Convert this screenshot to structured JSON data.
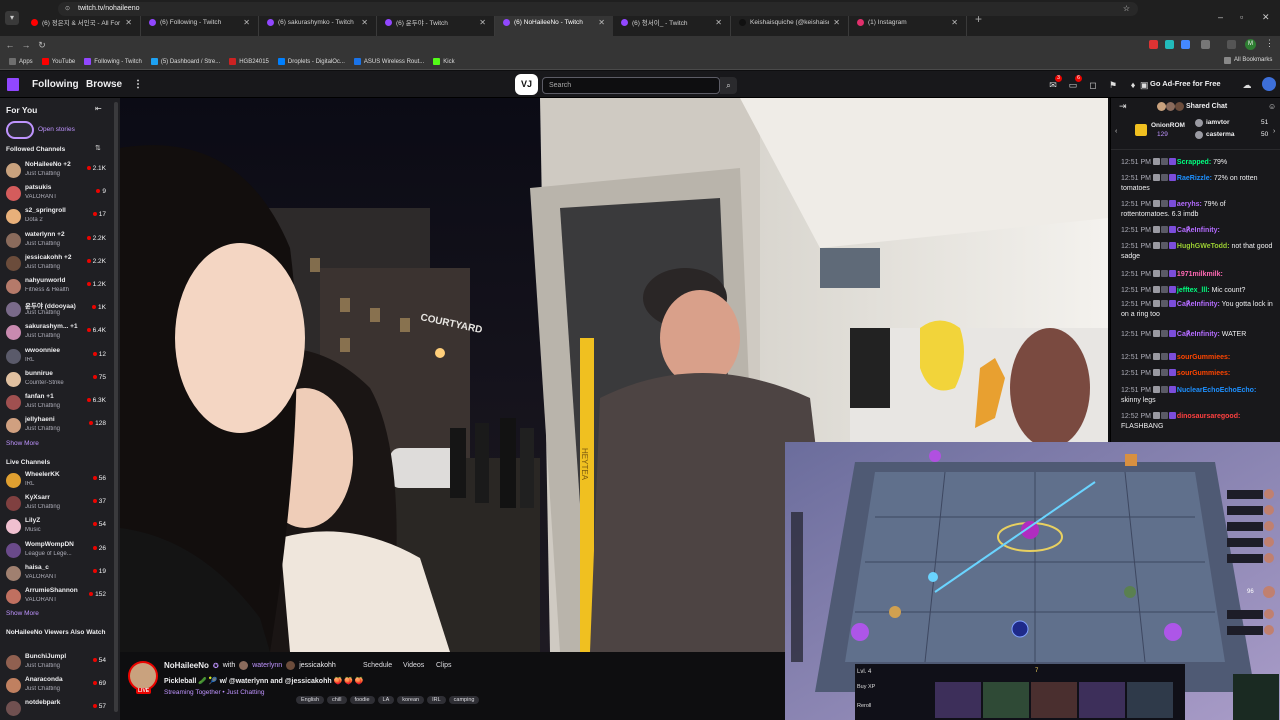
{
  "browser": {
    "tabs": [
      {
        "title": "(6) 정은지 & 서인국 - All For You",
        "color": "#ff0000"
      },
      {
        "title": "(6) Following - Twitch",
        "color": "#9147ff"
      },
      {
        "title": "(6) sakurashymko - Twitch",
        "color": "#9147ff"
      },
      {
        "title": "(6) 윤두야 - Twitch",
        "color": "#9147ff"
      },
      {
        "title": "(6) NoHaileeNo - Twitch",
        "color": "#9147ff"
      },
      {
        "title": "(6) 청서이_ - Twitch",
        "color": "#9147ff"
      },
      {
        "title": "Keishaisquiche (@keishaisquiche",
        "color": "#111111"
      },
      {
        "title": "(1) Instagram",
        "color": "#e1306c"
      }
    ],
    "url": "twitch.tv/nohaileeno",
    "bookmarks": [
      {
        "label": "Apps",
        "color": "#6e6e6e"
      },
      {
        "label": "YouTube",
        "color": "#ff0000"
      },
      {
        "label": "Following - Twitch",
        "color": "#9147ff"
      },
      {
        "label": "(5) Dashboard / Stre...",
        "color": "#1da1f2"
      },
      {
        "label": "HGB24015",
        "color": "#cc2222"
      },
      {
        "label": "Droplets - DigitalOc...",
        "color": "#0080ff"
      },
      {
        "label": "ASUS Wireless Rout...",
        "color": "#1a73e8"
      },
      {
        "label": "Kick",
        "color": "#53fc18"
      }
    ],
    "all_bookmarks": "All Bookmarks",
    "profile_letter": "M"
  },
  "topnav": {
    "following": "Following",
    "browse": "Browse",
    "more": "⋮",
    "vj_logo": "VJ",
    "search_placeholder": "Search",
    "ad_free": "Go Ad-Free for Free",
    "badge_a": "3",
    "badge_b": "6"
  },
  "sidebar": {
    "for_you": "For You",
    "open_stories": "Open stories",
    "followed_channels": "Followed Channels",
    "followed": [
      {
        "name": "NoHaileeNo +2",
        "game": "Just Chatting",
        "viewers": "2.1K",
        "color": "#c9a27e"
      },
      {
        "name": "patsukis",
        "game": "VALORANT",
        "viewers": "9",
        "color": "#d45c5c"
      },
      {
        "name": "s2_springroll",
        "game": "Dota 2",
        "viewers": "17",
        "color": "#e8b07a"
      },
      {
        "name": "waterlynn +2",
        "game": "Just Chatting",
        "viewers": "2.2K",
        "color": "#8a6b5c"
      },
      {
        "name": "jessicakohh +2",
        "game": "Just Chatting",
        "viewers": "2.2K",
        "color": "#6b4c3b"
      },
      {
        "name": "nahyunworld",
        "game": "Fitness & Health",
        "viewers": "1.2K",
        "color": "#b57a6a"
      },
      {
        "name": "윤두야 (ddooyaa)",
        "game": "Just Chatting",
        "viewers": "1K",
        "color": "#7a6a8a"
      },
      {
        "name": "sakurashym... +1",
        "game": "Just Chatting",
        "viewers": "6.4K",
        "color": "#c98ab0"
      },
      {
        "name": "wwoonniee",
        "game": "IRL",
        "viewers": "12",
        "color": "#5a5a6a"
      },
      {
        "name": "bunnirue",
        "game": "Counter-Strike",
        "viewers": "75",
        "color": "#e0c0a0"
      },
      {
        "name": "fanfan +1",
        "game": "Just Chatting",
        "viewers": "6.3K",
        "color": "#a05050"
      },
      {
        "name": "jellyhaeni",
        "game": "Just Chatting",
        "viewers": "128",
        "color": "#d0a080"
      }
    ],
    "show_more": "Show More",
    "live_channels": "Live Channels",
    "live": [
      {
        "name": "WheelerKK",
        "game": "IRL",
        "viewers": "56",
        "color": "#e0a030"
      },
      {
        "name": "KyXsarr",
        "game": "Just Chatting",
        "viewers": "37",
        "color": "#804040"
      },
      {
        "name": "LilyZ",
        "game": "Music",
        "viewers": "54",
        "color": "#f0c0d0"
      },
      {
        "name": "WompWompDN",
        "game": "League of Lege...",
        "viewers": "26",
        "color": "#6a4a8a"
      },
      {
        "name": "haisa_c",
        "game": "VALORANT",
        "viewers": "19",
        "color": "#a08070"
      },
      {
        "name": "ArrumieShannon",
        "game": "VALORANT",
        "viewers": "152",
        "color": "#c07060"
      }
    ],
    "show_more_2": "Show More",
    "viewers_also_watch": "NoHaileeNo Viewers Also Watch",
    "also": [
      {
        "name": "BunchiJumpl",
        "game": "Just Chatting",
        "viewers": "54",
        "color": "#906050"
      },
      {
        "name": "Anaraconda",
        "game": "Just Chatting",
        "viewers": "69",
        "color": "#c08060"
      },
      {
        "name": "notdebpark",
        "game": "",
        "viewers": "57",
        "color": "#705050"
      }
    ]
  },
  "stream": {
    "channel": "NoHaileeNo",
    "with": "with",
    "collab1": "waterlynn",
    "collab2": "jessicakohh",
    "tabs": [
      "Schedule",
      "Videos",
      "Clips"
    ],
    "title": "Pickleball 🥒 🎾 w/ @waterlynn and @jessicakohh 🍑 🍑 🍑",
    "live": "LIVE",
    "streaming_together": "Streaming Together • Just Chatting",
    "tags": [
      "English",
      "chill",
      "foodie",
      "LA",
      "korean",
      "IRL",
      "camping"
    ],
    "sign_courtyard": "COURTYARD",
    "sign_heytea": "HEYTEA"
  },
  "chat": {
    "title": "Shared Chat",
    "gifter1": {
      "name": "OnionROM",
      "count": "129"
    },
    "gifter2": {
      "name": "iamvtor",
      "count": "51"
    },
    "gifter3": {
      "name": "casterma",
      "count": "50"
    },
    "messages": [
      {
        "time": "12:51 PM",
        "user": "Scrapped:",
        "color": "#00ff7f",
        "text": "79%"
      },
      {
        "time": "12:51 PM",
        "user": "RaeRizzle:",
        "color": "#1e90ff",
        "text": "72% on rotten tomatoes"
      },
      {
        "time": "12:51 PM",
        "user": "aeryhs:",
        "color": "#b36bff",
        "text": "79% of rottentomatoes. 6.3 imdb"
      },
      {
        "time": "12:51 PM",
        "user": "Ca℟eInfinity:",
        "color": "#b36bff",
        "text": ""
      },
      {
        "time": "12:51 PM",
        "user": "HughGWeTodd:",
        "color": "#9acd32",
        "text": "not that good sadge"
      },
      {
        "time": "12:51 PM",
        "user": "1971milkmilk:",
        "color": "#ff69b4",
        "text": ""
      },
      {
        "time": "12:51 PM",
        "user": "jefftex_lll:",
        "color": "#00ff7f",
        "text": "Mic count?"
      },
      {
        "time": "12:51 PM",
        "user": "Ca℟eInfinity:",
        "color": "#b36bff",
        "text": "You gotta lock in on a ring too"
      },
      {
        "time": "12:51 PM",
        "user": "Ca℟eInfinity:",
        "color": "#b36bff",
        "text": "WATER"
      },
      {
        "time": "12:51 PM",
        "user": "sourGummiees:",
        "color": "#ff4500",
        "text": ""
      },
      {
        "time": "12:51 PM",
        "user": "sourGummiees:",
        "color": "#ff4500",
        "text": ""
      },
      {
        "time": "12:51 PM",
        "user": "NuclearEchoEchoEcho:",
        "color": "#1e90ff",
        "text": "skinny legs"
      },
      {
        "time": "12:52 PM",
        "user": "dinosaursaregood:",
        "color": "#ff4040",
        "text": "FLASHBANG"
      }
    ]
  },
  "game": {
    "level": "Lvl. 4",
    "buy_xp": "Buy XP",
    "reroll": "Reroll",
    "gold": "96",
    "hud_center": "7"
  }
}
